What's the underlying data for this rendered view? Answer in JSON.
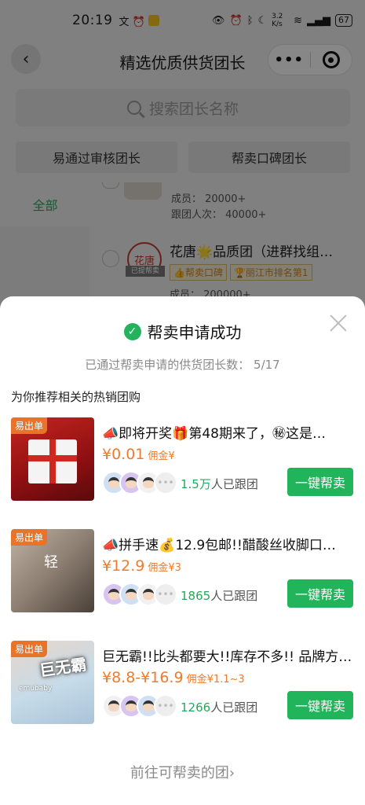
{
  "status_bar": {
    "time": "20:19",
    "left_icons": "文 ⏰",
    "network_speed": "3.2 K/s",
    "battery": "67"
  },
  "nav": {
    "back_icon": "‹",
    "title": "精选优质供货团长",
    "more_label": "•••"
  },
  "search": {
    "placeholder": "搜索团长名称"
  },
  "filters": [
    "易通过审核团长",
    "帮卖口碑团长"
  ],
  "left_menu": {
    "active": "全部"
  },
  "bg_list": {
    "item1": {
      "members": "成员：  20000+",
      "followers": "跟团人次：  40000+"
    },
    "item2": {
      "seal_text": "花唐",
      "seal_tag": "已提帮卖",
      "name": "花唐🌟品质团（进群找组…",
      "badge1": "👍帮卖口碑",
      "badge2": "🏆丽江市排名第1",
      "members": "成员：  200000+"
    }
  },
  "sheet": {
    "title": "帮卖申请成功",
    "subtitle": "已通过帮卖申请的供货团长数：  5/17",
    "section_title": "为你推荐相关的热销团购",
    "goto_link": "前往可帮卖的团›",
    "cards": [
      {
        "tag": "易出单",
        "title": "📣即将开奖🎁第48期来了，㊙这是…",
        "price": "¥0.01",
        "commission": "佣金¥",
        "follower_num": "1.5万",
        "follower_suffix": "人已跟团",
        "button": "一键帮卖"
      },
      {
        "tag": "易出单",
        "title": "📣拼手速💰12.9包邮!!醋酸丝收脚口…",
        "price": "¥12.9",
        "commission": "佣金¥3",
        "follower_num": "1865",
        "follower_suffix": "人已跟团",
        "button": "一键帮卖",
        "thumb_text": "轻"
      },
      {
        "tag": "易出单",
        "title": "巨无霸!!比头都要大!!库存不多!! 品牌方…",
        "price": "¥8.8-¥16.9",
        "commission": "佣金¥1.1~3",
        "follower_num": "1266",
        "follower_suffix": "人已跟团",
        "button": "一键帮卖",
        "thumb_text": "巨无霸",
        "thumb_small": "emubaby"
      }
    ]
  },
  "colors": {
    "accent_green": "#22b45b",
    "price_orange": "#f07a2c",
    "tag_orange": "#e8742a"
  }
}
